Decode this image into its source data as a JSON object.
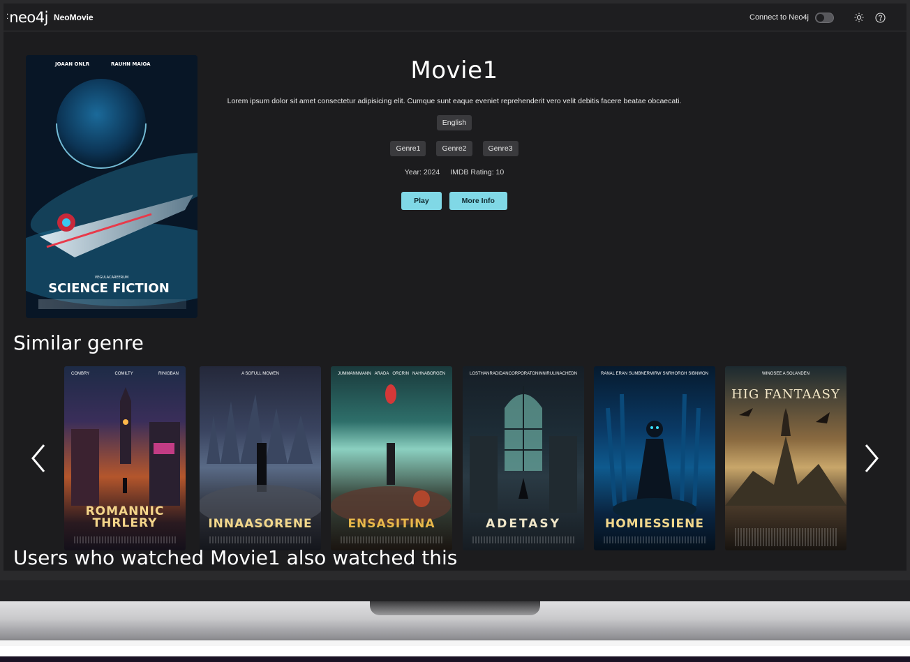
{
  "header": {
    "logo_text": "neo4j",
    "app_name": "NeoMovie",
    "connect_label": "Connect to Neo4j",
    "toggle_on": false
  },
  "hero": {
    "poster": {
      "top_credits": [
        "JOAAN ONLR",
        "RAUHN MAIOA"
      ],
      "tagline": "VEGULACAREERUM",
      "title": "SCIENCE FICTION"
    },
    "title": "Movie1",
    "description": "Lorem ipsum dolor sit amet consectetur adipisicing elit. Cumque sunt eaque eveniet reprehenderit vero velit debitis facere beatae obcaecati.",
    "language": "English",
    "genres": [
      "Genre1",
      "Genre2",
      "Genre3"
    ],
    "year_text": "Year: 2024",
    "rating_text": "IMDB Rating: 10",
    "play_label": "Play",
    "more_info_label": "More Info"
  },
  "similar": {
    "title": "Similar genre",
    "posters": [
      {
        "title": "ROMANNIC\nTHRLERY",
        "credits": [
          "COMBRY",
          "COMILTY",
          "RINIGBAN"
        ]
      },
      {
        "title": "INNAASORENE",
        "credits": [
          "A SOFULL MOWEN"
        ]
      },
      {
        "title": "ENSASITINA",
        "credits": [
          "JUMMANNMANN",
          "ARADA",
          "ORCRIN",
          "NAHNABORGEN"
        ]
      },
      {
        "title": "ADETASY",
        "credits": [
          "LOSTHAN",
          "RADIDAN",
          "CORPORATON",
          "INNIRUL",
          "INACHEDN"
        ]
      },
      {
        "title": "HOMIESSIENE",
        "credits": [
          "RANAL ERAN",
          "SUMBNERMIRW",
          "SNRHORGH",
          "SIBNWON"
        ]
      },
      {
        "title": "HIG FANTAASY",
        "credits": [
          "WINOSEE A SOLANDEN"
        ]
      }
    ]
  },
  "also_watched": {
    "title": "Users who watched Movie1 also watched this"
  },
  "colors": {
    "accent": "#80d8e6",
    "background": "#1c1c1e",
    "chip": "#3a3a3d"
  }
}
